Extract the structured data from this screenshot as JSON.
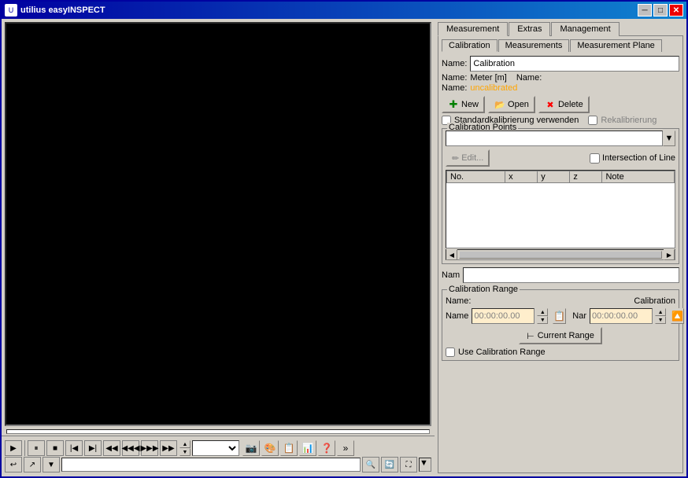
{
  "window": {
    "title": "utilius easyINSPECT",
    "min_label": "─",
    "max_label": "□",
    "close_label": "✕"
  },
  "tabs": {
    "main": [
      "Measurement",
      "Extras",
      "Management"
    ],
    "active_main": "Measurement",
    "sub": [
      "Calibration",
      "Measurements",
      "Measurement Plane"
    ],
    "active_sub": "Calibration"
  },
  "calibration": {
    "name_label": "Name:",
    "name_value": "Calibration",
    "meter_label": "Name:",
    "meter_value": "Meter [m]",
    "name2_label": "Name:",
    "status_label": "Name:",
    "status_value": "uncalibrated",
    "btn_new": "New",
    "btn_open": "Open",
    "btn_delete": "Delete",
    "checkbox_std": "Standardkalibrierung verwenden",
    "checkbox_recal": "Rekalibrierung",
    "group_cal_points": "Calibration Points",
    "dropdown_placeholder": "",
    "edit_btn": "Edit...",
    "checkbox_intersection": "Intersection of Line",
    "table_headers": [
      "No.",
      "x",
      "y",
      "z",
      "Note"
    ],
    "nam_label": "Nam",
    "cal_range_group": "Calibration Range",
    "cal_range_name_label": "Name:",
    "cal_range_cal_label": "Calibration",
    "name_time_label": "Name",
    "name_time_value": "00:00:00.00",
    "nar_label": "Nar",
    "nar_time_value": "00:00:00.00",
    "current_range_btn": "Current Range",
    "use_cal_range_checkbox": "Use Calibration Range"
  },
  "controls": {
    "play": "▶",
    "pause": "⏸",
    "stop": "■",
    "prev_frame": "◀◀",
    "next_frame": "▶▶",
    "prev": "◀",
    "next": "▶",
    "rewind": "◀◀◀",
    "fforward": "▶▶▶",
    "up1": "▲",
    "down1": "▼",
    "up2": "▲",
    "down2": "▼"
  }
}
